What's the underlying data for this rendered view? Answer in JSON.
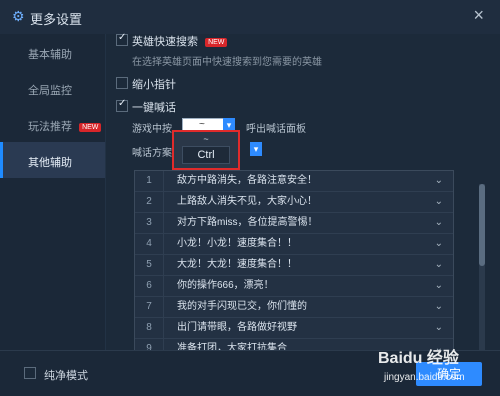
{
  "window": {
    "title": "更多设置"
  },
  "sidebar": {
    "items": [
      {
        "label": "基本辅助"
      },
      {
        "label": "全局监控"
      },
      {
        "label": "玩法推荐",
        "badge": "NEW"
      },
      {
        "label": "其他辅助",
        "active": true
      }
    ]
  },
  "main": {
    "hero_search": {
      "label": "英雄快速搜索",
      "badge": "NEW",
      "checked": true,
      "desc": "在选择英雄页面中快速搜索到您需要的英雄"
    },
    "minimap": {
      "label": "缩小指针",
      "checked": false
    },
    "shout": {
      "label": "一键喊话",
      "checked": true,
      "key_label": "游戏中按",
      "key_value": "~",
      "key_hint": "呼出喊话面板",
      "plan_label": "喊话方案"
    },
    "popup": {
      "option1": "~",
      "option2": "Ctrl"
    }
  },
  "messages": [
    {
      "num": "1",
      "text": "敌方中路消失，各路注意安全！"
    },
    {
      "num": "2",
      "text": "上路敌人消失不见，大家小心！"
    },
    {
      "num": "3",
      "text": "对方下路miss，各位提高警惕！"
    },
    {
      "num": "4",
      "text": "小龙！小龙！速度集合！！"
    },
    {
      "num": "5",
      "text": "大龙！大龙！速度集合！！"
    },
    {
      "num": "6",
      "text": "你的操作666，漂亮！"
    },
    {
      "num": "7",
      "text": "我的对手闪现已交，你们懂的"
    },
    {
      "num": "8",
      "text": "出门请带眼，各路做好视野"
    },
    {
      "num": "9",
      "text": "准备打团，大家打抗集合"
    }
  ],
  "footer": {
    "pure_mode_label": "纯净模式",
    "ok_label": "确定"
  },
  "watermark": {
    "line1": "Baidu 经验",
    "line2": "jingyan.baidu.com"
  },
  "colors": {
    "accent": "#2e8bff",
    "highlight_border": "#e02b2b",
    "badge": "#d7262a"
  }
}
